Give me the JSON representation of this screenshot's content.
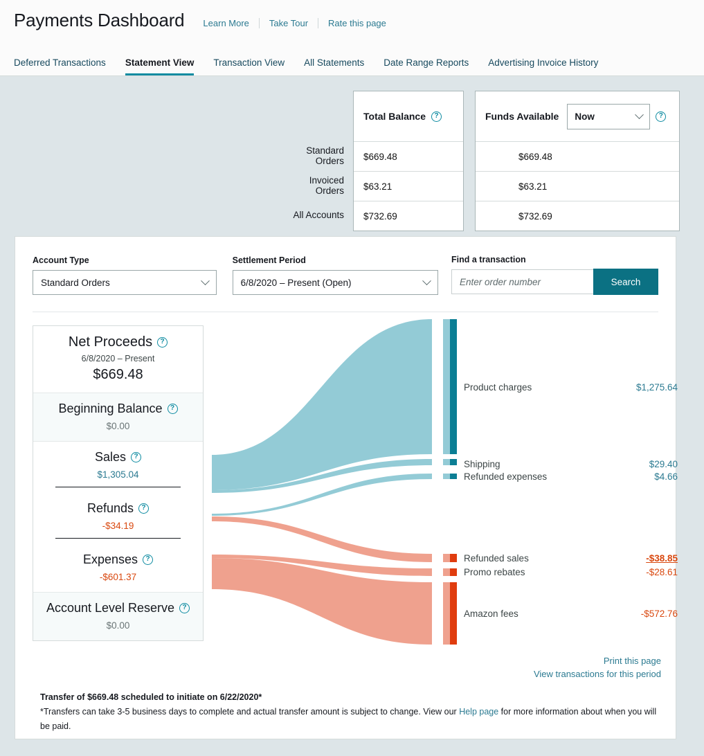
{
  "header": {
    "title": "Payments Dashboard",
    "links": [
      "Learn More",
      "Take Tour",
      "Rate this page"
    ],
    "tabs": [
      {
        "label": "Deferred Transactions",
        "active": false
      },
      {
        "label": "Statement View",
        "active": true
      },
      {
        "label": "Transaction View",
        "active": false
      },
      {
        "label": "All Statements",
        "active": false
      },
      {
        "label": "Date Range Reports",
        "active": false
      },
      {
        "label": "Advertising Invoice History",
        "active": false
      }
    ]
  },
  "balance": {
    "total_balance_header": "Total Balance",
    "funds_available_header": "Funds Available",
    "funds_period_value": "Now",
    "rows": [
      {
        "label": "Standard Orders",
        "total": "$669.48",
        "available": "$669.48"
      },
      {
        "label": "Invoiced Orders",
        "total": "$63.21",
        "available": "$63.21"
      },
      {
        "label": "All Accounts",
        "total": "$732.69",
        "available": "$732.69"
      }
    ]
  },
  "filters": {
    "account_type_label": "Account Type",
    "account_type_value": "Standard Orders",
    "settlement_label": "Settlement Period",
    "settlement_value": "6/8/2020 – Present (Open)",
    "find_label": "Find a transaction",
    "find_placeholder": "Enter order number",
    "search_label": "Search"
  },
  "summary": {
    "net_proceeds_label": "Net Proceeds",
    "net_proceeds_period": "6/8/2020 – Present",
    "net_proceeds_amount": "$669.48",
    "beginning_balance_label": "Beginning Balance",
    "beginning_balance_value": "$0.00",
    "sales_label": "Sales",
    "sales_value": "$1,305.04",
    "refunds_label": "Refunds",
    "refunds_value": "-$34.19",
    "expenses_label": "Expenses",
    "expenses_value": "-$601.37",
    "reserve_label": "Account Level Reserve",
    "reserve_value": "$0.00"
  },
  "chart_data": {
    "type": "sankey",
    "title": "Net Proceeds flow",
    "colors": {
      "flow_positive": "#93cbd6",
      "node_positive": "#0b7e94",
      "flow_negative": "#efa18e",
      "node_negative": "#e03c0e"
    },
    "sources": [
      {
        "name": "Sales",
        "value": 1305.04,
        "sign": "positive"
      },
      {
        "name": "Refunds",
        "value": -34.19,
        "sign": "negative"
      },
      {
        "name": "Expenses",
        "value": -601.37,
        "sign": "negative"
      }
    ],
    "targets": [
      {
        "name": "Product charges",
        "label": "$1,275.64",
        "value": 1275.64,
        "sign": "positive",
        "hover": false
      },
      {
        "name": "Shipping",
        "label": "$29.40",
        "value": 29.4,
        "sign": "positive",
        "hover": false
      },
      {
        "name": "Refunded expenses",
        "label": "$4.66",
        "value": 4.66,
        "sign": "positive",
        "hover": false
      },
      {
        "name": "Refunded sales",
        "label": "-$38.85",
        "value": -38.85,
        "sign": "negative",
        "hover": true
      },
      {
        "name": "Promo rebates",
        "label": "-$28.61",
        "value": -28.61,
        "sign": "negative",
        "hover": false
      },
      {
        "name": "Amazon fees",
        "label": "-$572.76",
        "value": -572.76,
        "sign": "negative",
        "hover": false
      }
    ],
    "links": [
      {
        "source": "Sales",
        "target": "Product charges",
        "value": 1275.64
      },
      {
        "source": "Sales",
        "target": "Shipping",
        "value": 29.4
      },
      {
        "source": "Refunds",
        "target": "Refunded expenses",
        "value": 4.66
      },
      {
        "source": "Refunds",
        "target": "Refunded sales",
        "value": 38.85
      },
      {
        "source": "Expenses",
        "target": "Promo rebates",
        "value": 28.61
      },
      {
        "source": "Expenses",
        "target": "Amazon fees",
        "value": 572.76
      }
    ]
  },
  "footer": {
    "print_link": "Print this page",
    "view_link": "View transactions for this period",
    "transfer_line": "Transfer of $669.48 scheduled to initiate on 6/22/2020*",
    "note_part1": "*Transfers can take 3-5 business days to complete and actual transfer amount is subject to change. View our ",
    "note_link": "Help page",
    "note_part2": " for more information about when you will be paid."
  },
  "icons": {
    "help": "?",
    "chevron_down": "chevron-down-icon"
  }
}
